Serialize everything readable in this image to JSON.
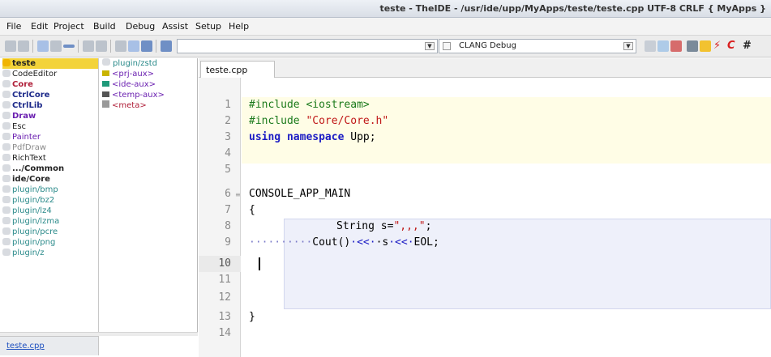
{
  "window": {
    "title": "teste - TheIDE - /usr/ide/upp/MyApps/teste/teste.cpp UTF-8 CRLF { MyApps }"
  },
  "menu": [
    "File",
    "Edit",
    "Project",
    "Build",
    "Debug",
    "Assist",
    "Setup",
    "Help"
  ],
  "toolbar": {
    "build_method": "CLANG Debug",
    "target_combo_value": ""
  },
  "packages": [
    {
      "label": "teste",
      "style": "selected"
    },
    {
      "label": "CodeEditor",
      "style": "dark"
    },
    {
      "label": "Core",
      "style": "red-bold"
    },
    {
      "label": "CtrlCore",
      "style": "navy-bold"
    },
    {
      "label": "CtrlLib",
      "style": "navy-bold"
    },
    {
      "label": "Draw",
      "style": "purple-bold"
    },
    {
      "label": "Esc",
      "style": "dark"
    },
    {
      "label": "Painter",
      "style": "purple"
    },
    {
      "label": "PdfDraw",
      "style": "grey"
    },
    {
      "label": "RichText",
      "style": "dark"
    },
    {
      "label": ".../Common",
      "style": "dark-bold"
    },
    {
      "label": "ide/Core",
      "style": "dark-bold"
    },
    {
      "label": "plugin/bmp",
      "style": "teal"
    },
    {
      "label": "plugin/bz2",
      "style": "teal"
    },
    {
      "label": "plugin/lz4",
      "style": "teal"
    },
    {
      "label": "plugin/lzma",
      "style": "teal"
    },
    {
      "label": "plugin/pcre",
      "style": "teal"
    },
    {
      "label": "plugin/png",
      "style": "teal"
    },
    {
      "label": "plugin/z",
      "style": "teal"
    }
  ],
  "files": [
    {
      "label": "plugin/zstd",
      "color": "#2a8a8a",
      "swatch": ""
    },
    {
      "label": "<prj-aux>",
      "color": "#6a1fb0",
      "swatch": "#c9b400"
    },
    {
      "label": "<ide-aux>",
      "color": "#6a1fb0",
      "swatch": "#1f9a7a"
    },
    {
      "label": "<temp-aux>",
      "color": "#6a1fb0",
      "swatch": "#555555"
    },
    {
      "label": "<meta>",
      "color": "#b0203a",
      "swatch": "#999999"
    }
  ],
  "bottom_tab": "teste.cpp",
  "editor": {
    "tab_label": "teste.cpp",
    "line_numbers": [
      "1",
      "2",
      "3",
      "4",
      "5",
      "6",
      "7",
      "8",
      "9",
      "10",
      "11",
      "12",
      "13",
      "14"
    ],
    "current_line": "10"
  },
  "code": {
    "l1_directive": "#include",
    "l1_file": "<iostream>",
    "l2_directive": "#include",
    "l2_file": "\"Core/Core.h\"",
    "l3_using": "using",
    "l3_namespace": "namespace",
    "l3_rest": "Upp;",
    "l6": "CONSOLE_APP_MAIN",
    "l7": "{",
    "l8_type": "String s=",
    "l8_str": "\",,,\"",
    "l8_end": ";",
    "l9_dots": "··········",
    "l9_a": "Cout()",
    "l9_op1": "·<<·",
    "l9_b": "·s",
    "l9_op2": "·<<·",
    "l9_c": "EOL;",
    "l13": "}"
  }
}
